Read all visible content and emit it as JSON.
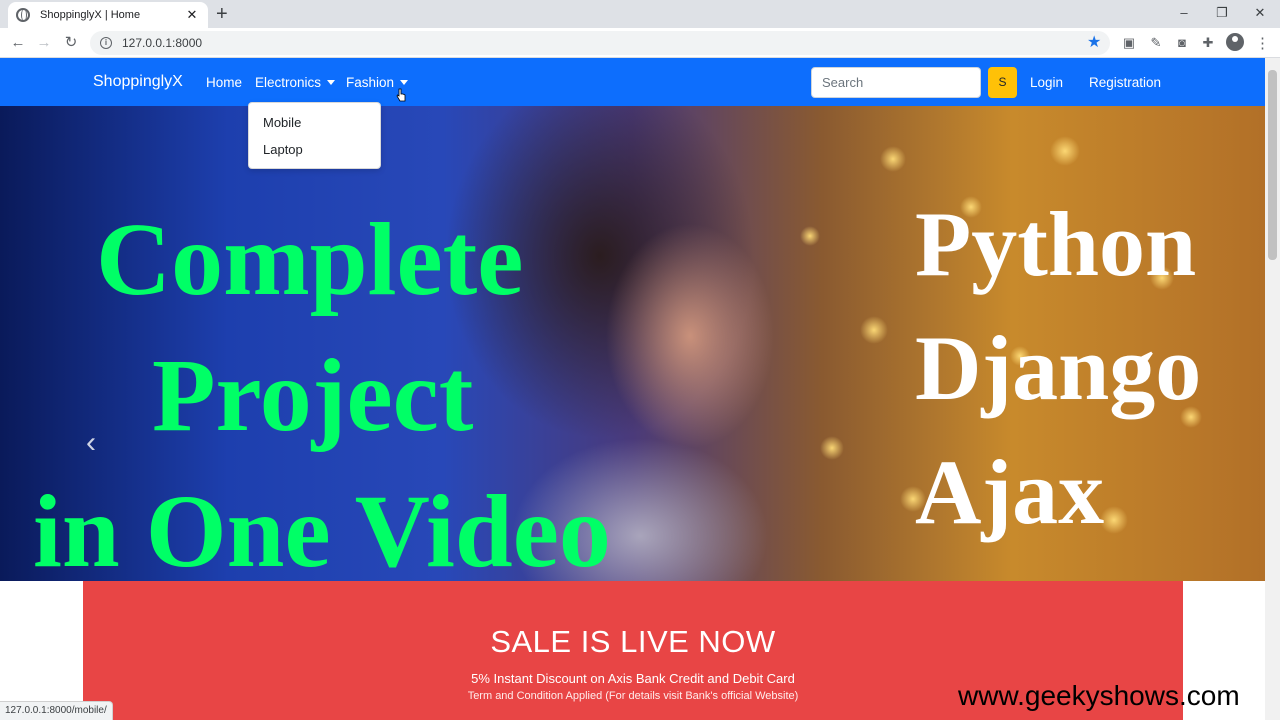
{
  "browser": {
    "tab_title": "ShoppinglyX | Home",
    "tab_close": "✕",
    "new_tab": "+",
    "url": "127.0.0.1:8000",
    "status_url": "127.0.0.1:8000/mobile/",
    "win_min": "–",
    "win_max": "❐",
    "win_close": "✕"
  },
  "navbar": {
    "brand": "ShoppinglyX",
    "home": "Home",
    "electronics": "Electronics",
    "fashion": "Fashion",
    "search_placeholder": "Search",
    "search_button": "S",
    "login": "Login",
    "registration": "Registration"
  },
  "dropdown": {
    "items": [
      "Mobile",
      "Laptop"
    ]
  },
  "hero": {
    "prev": "‹",
    "overlay_left": [
      "Complete",
      "Project",
      "in One Video"
    ],
    "overlay_right": [
      "Python",
      "Django",
      "Ajax"
    ]
  },
  "sale": {
    "title": "SALE IS LIVE NOW",
    "subtitle": "5% Instant Discount on Axis Bank Credit and Debit Card",
    "note": "Term and Condition Applied (For details visit Bank's official Website)"
  },
  "watermark": "www.geekyshows.com",
  "colors": {
    "navbar": "#0d6efd",
    "search_button": "#ffc107",
    "sale_banner": "#e84545",
    "overlay_green": "#00ff66"
  }
}
